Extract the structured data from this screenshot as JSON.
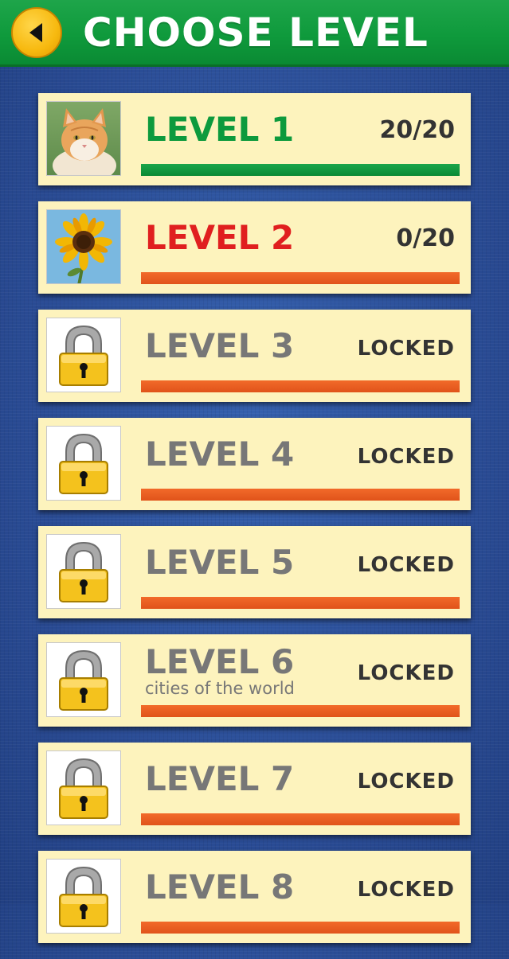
{
  "header": {
    "title": "CHOOSE LEVEL",
    "back_icon": "back-arrow-icon"
  },
  "colors": {
    "header_green": "#0f9a3c",
    "background_blue": "#2b4e99",
    "card_cream": "#fdf3bd",
    "completed_green": "#0d9a3d",
    "current_red": "#e01f1f",
    "locked_gray": "#777777",
    "progress_orange": "#ee6224",
    "button_yellow": "#f7b90f"
  },
  "levels": [
    {
      "title": "LEVEL 1",
      "status": "20/20",
      "progress": 1.0,
      "state": "completed",
      "thumbnail": "cat-photo-icon"
    },
    {
      "title": "LEVEL 2",
      "status": "0/20",
      "progress": 0.0,
      "state": "current",
      "thumbnail": "sunflower-photo-icon"
    },
    {
      "title": "LEVEL 3",
      "status": "LOCKED",
      "progress": 0.0,
      "state": "locked",
      "thumbnail": "padlock-icon"
    },
    {
      "title": "LEVEL 4",
      "status": "LOCKED",
      "progress": 0.0,
      "state": "locked",
      "thumbnail": "padlock-icon"
    },
    {
      "title": "LEVEL 5",
      "status": "LOCKED",
      "progress": 0.0,
      "state": "locked",
      "thumbnail": "padlock-icon"
    },
    {
      "title": "LEVEL 6",
      "subtitle": "cities of the world",
      "status": "LOCKED",
      "progress": 0.0,
      "state": "locked",
      "thumbnail": "padlock-icon"
    },
    {
      "title": "LEVEL 7",
      "status": "LOCKED",
      "progress": 0.0,
      "state": "locked",
      "thumbnail": "padlock-icon"
    },
    {
      "title": "LEVEL 8",
      "status": "LOCKED",
      "progress": 0.0,
      "state": "locked",
      "thumbnail": "padlock-icon"
    }
  ]
}
